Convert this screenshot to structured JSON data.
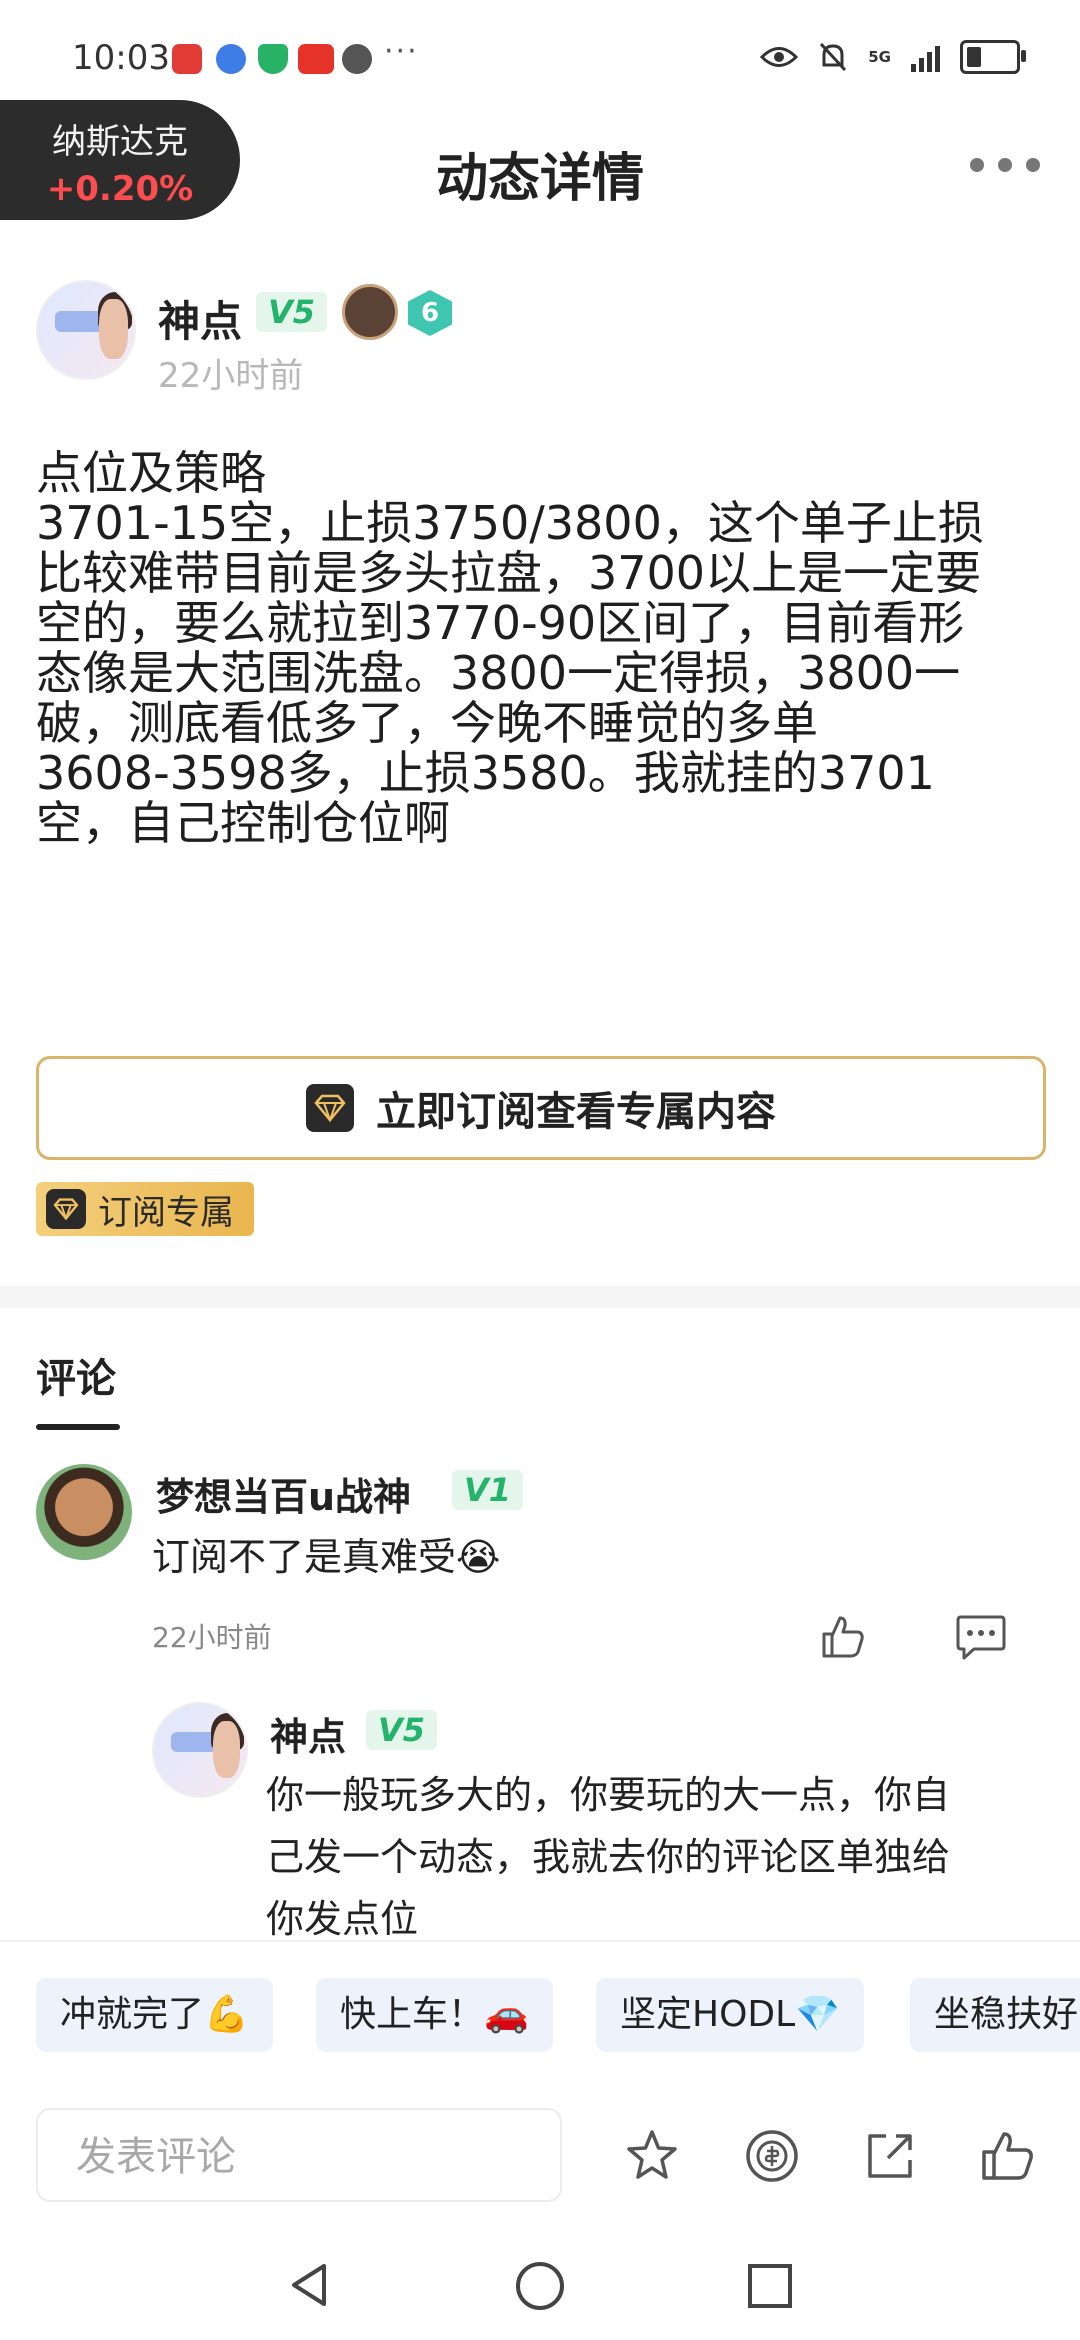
{
  "status_bar": {
    "time": "10:03",
    "dots": "···",
    "network": "5G"
  },
  "header": {
    "ticker_name": "纳斯达克",
    "ticker_change": "+0.20%",
    "title": "动态详情"
  },
  "author": {
    "name": "神点",
    "level": "V5",
    "badge_count": "6",
    "time": "22小时前"
  },
  "post": {
    "lines": [
      "点位及策略",
      "3701-15空，止损3750/3800，这个单子止损",
      "比较难带目前是多头拉盘，3700以上是一定要",
      "空的，要么就拉到3770-90区间了，目前看形",
      "态像是大范围洗盘。3800一定得损，3800一",
      "破，测底看低多了，今晚不睡觉的多单",
      "3608-3598多，止损3580。我就挂的3701",
      "空，自己控制仓位啊"
    ],
    "subscribe_label": "立即订阅查看专属内容",
    "tag_label": "订阅专属"
  },
  "comments": {
    "tab_label": "评论",
    "items": [
      {
        "name": "梦想当百u战神",
        "level": "V1",
        "text": "订阅不了是真难受😭",
        "time": "22小时前"
      }
    ],
    "reply": {
      "name": "神点",
      "level": "V5",
      "lines": [
        "你一般玩多大的，你要玩的大一点，你自",
        "己发一个动态，我就去你的评论区单独给",
        "你发点位"
      ]
    }
  },
  "quick_reactions": [
    "冲就完了💪",
    "快上车！🚗",
    "坚定HODL💎",
    "坐稳扶好"
  ],
  "composer": {
    "placeholder": "发表评论"
  },
  "colors": {
    "up_red": "#ff4d4f",
    "vip_gold": "#d9b46a",
    "level_green": "#24b36b"
  }
}
